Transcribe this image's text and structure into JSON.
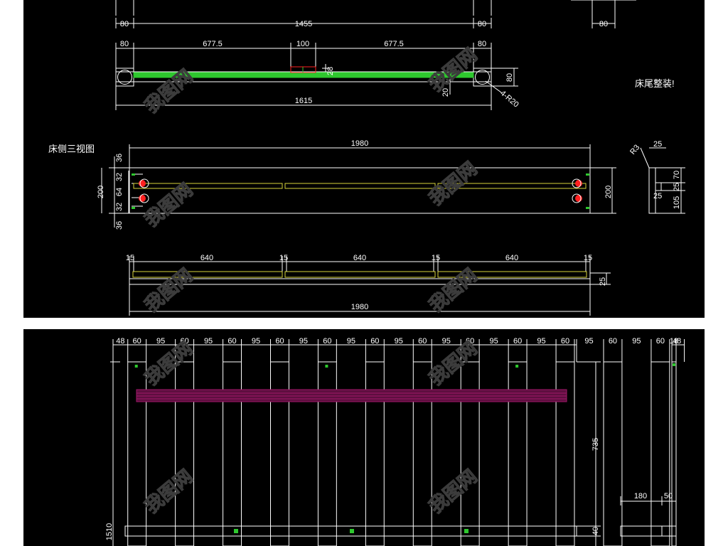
{
  "top": {
    "dims_row1": [
      "80",
      "1455",
      "80",
      "80"
    ],
    "dims_row2": [
      "80",
      "677.5",
      "100",
      "677.5",
      "80"
    ],
    "rail_dims": {
      "h28": "28",
      "h80": "80",
      "h20": "20",
      "total": "1615",
      "radius": "4-R20"
    },
    "note_bed_end": "床尾整装!",
    "side_title": "床侧三视图",
    "side_length": "1980",
    "side_left": [
      "36",
      "32",
      "64",
      "32",
      "36"
    ],
    "side_height": "200",
    "side_right_height": "200",
    "section": {
      "r": "R3",
      "w": "25",
      "h70": "70",
      "h25": "25",
      "w25": "25",
      "h105": "105"
    },
    "slat_dims": [
      "15",
      "640",
      "15",
      "640",
      "15",
      "640",
      "15"
    ],
    "slat_height": "25",
    "slat_length": "1980"
  },
  "bottom": {
    "picket_dims": [
      "48",
      "60",
      "95",
      "60",
      "95",
      "60",
      "95",
      "60",
      "95",
      "60",
      "95",
      "60",
      "95",
      "60",
      "95",
      "60",
      "95",
      "60",
      "95",
      "60",
      "95",
      "60",
      "95",
      "60",
      "48"
    ],
    "height_total": "1510",
    "height_735": "735",
    "height_40": "40",
    "side_w18": "18",
    "side_180": "180",
    "side_50": "50"
  },
  "watermark": "我图网",
  "colors": {
    "line": "#ffffff",
    "slat": "#d6d23a",
    "green": "#2ec82e",
    "red": "#ff2020",
    "magenta": "#a0186a"
  }
}
